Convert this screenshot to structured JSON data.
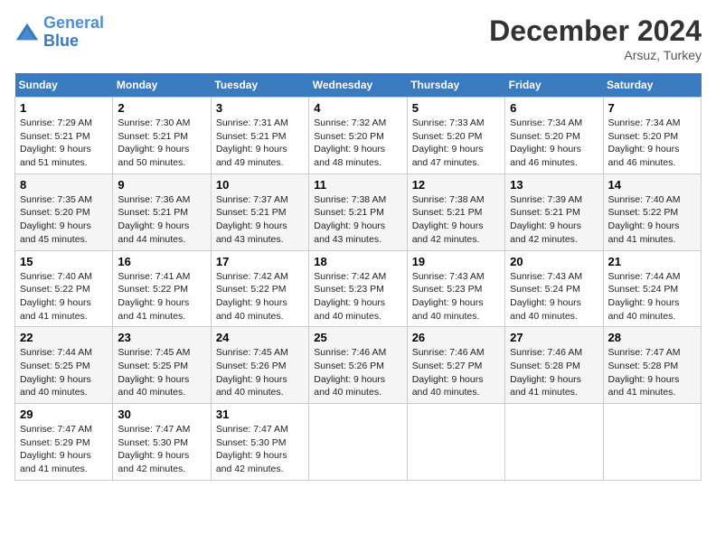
{
  "header": {
    "logo_line1": "General",
    "logo_line2": "Blue",
    "month": "December 2024",
    "location": "Arsuz, Turkey"
  },
  "days_of_week": [
    "Sunday",
    "Monday",
    "Tuesday",
    "Wednesday",
    "Thursday",
    "Friday",
    "Saturday"
  ],
  "weeks": [
    [
      {
        "day": 1,
        "sunrise": "7:29 AM",
        "sunset": "5:21 PM",
        "daylight": "9 hours and 51 minutes."
      },
      {
        "day": 2,
        "sunrise": "7:30 AM",
        "sunset": "5:21 PM",
        "daylight": "9 hours and 50 minutes."
      },
      {
        "day": 3,
        "sunrise": "7:31 AM",
        "sunset": "5:21 PM",
        "daylight": "9 hours and 49 minutes."
      },
      {
        "day": 4,
        "sunrise": "7:32 AM",
        "sunset": "5:20 PM",
        "daylight": "9 hours and 48 minutes."
      },
      {
        "day": 5,
        "sunrise": "7:33 AM",
        "sunset": "5:20 PM",
        "daylight": "9 hours and 47 minutes."
      },
      {
        "day": 6,
        "sunrise": "7:34 AM",
        "sunset": "5:20 PM",
        "daylight": "9 hours and 46 minutes."
      },
      {
        "day": 7,
        "sunrise": "7:34 AM",
        "sunset": "5:20 PM",
        "daylight": "9 hours and 46 minutes."
      }
    ],
    [
      {
        "day": 8,
        "sunrise": "7:35 AM",
        "sunset": "5:20 PM",
        "daylight": "9 hours and 45 minutes."
      },
      {
        "day": 9,
        "sunrise": "7:36 AM",
        "sunset": "5:21 PM",
        "daylight": "9 hours and 44 minutes."
      },
      {
        "day": 10,
        "sunrise": "7:37 AM",
        "sunset": "5:21 PM",
        "daylight": "9 hours and 43 minutes."
      },
      {
        "day": 11,
        "sunrise": "7:38 AM",
        "sunset": "5:21 PM",
        "daylight": "9 hours and 43 minutes."
      },
      {
        "day": 12,
        "sunrise": "7:38 AM",
        "sunset": "5:21 PM",
        "daylight": "9 hours and 42 minutes."
      },
      {
        "day": 13,
        "sunrise": "7:39 AM",
        "sunset": "5:21 PM",
        "daylight": "9 hours and 42 minutes."
      },
      {
        "day": 14,
        "sunrise": "7:40 AM",
        "sunset": "5:22 PM",
        "daylight": "9 hours and 41 minutes."
      }
    ],
    [
      {
        "day": 15,
        "sunrise": "7:40 AM",
        "sunset": "5:22 PM",
        "daylight": "9 hours and 41 minutes."
      },
      {
        "day": 16,
        "sunrise": "7:41 AM",
        "sunset": "5:22 PM",
        "daylight": "9 hours and 41 minutes."
      },
      {
        "day": 17,
        "sunrise": "7:42 AM",
        "sunset": "5:22 PM",
        "daylight": "9 hours and 40 minutes."
      },
      {
        "day": 18,
        "sunrise": "7:42 AM",
        "sunset": "5:23 PM",
        "daylight": "9 hours and 40 minutes."
      },
      {
        "day": 19,
        "sunrise": "7:43 AM",
        "sunset": "5:23 PM",
        "daylight": "9 hours and 40 minutes."
      },
      {
        "day": 20,
        "sunrise": "7:43 AM",
        "sunset": "5:24 PM",
        "daylight": "9 hours and 40 minutes."
      },
      {
        "day": 21,
        "sunrise": "7:44 AM",
        "sunset": "5:24 PM",
        "daylight": "9 hours and 40 minutes."
      }
    ],
    [
      {
        "day": 22,
        "sunrise": "7:44 AM",
        "sunset": "5:25 PM",
        "daylight": "9 hours and 40 minutes."
      },
      {
        "day": 23,
        "sunrise": "7:45 AM",
        "sunset": "5:25 PM",
        "daylight": "9 hours and 40 minutes."
      },
      {
        "day": 24,
        "sunrise": "7:45 AM",
        "sunset": "5:26 PM",
        "daylight": "9 hours and 40 minutes."
      },
      {
        "day": 25,
        "sunrise": "7:46 AM",
        "sunset": "5:26 PM",
        "daylight": "9 hours and 40 minutes."
      },
      {
        "day": 26,
        "sunrise": "7:46 AM",
        "sunset": "5:27 PM",
        "daylight": "9 hours and 40 minutes."
      },
      {
        "day": 27,
        "sunrise": "7:46 AM",
        "sunset": "5:28 PM",
        "daylight": "9 hours and 41 minutes."
      },
      {
        "day": 28,
        "sunrise": "7:47 AM",
        "sunset": "5:28 PM",
        "daylight": "9 hours and 41 minutes."
      }
    ],
    [
      {
        "day": 29,
        "sunrise": "7:47 AM",
        "sunset": "5:29 PM",
        "daylight": "9 hours and 41 minutes."
      },
      {
        "day": 30,
        "sunrise": "7:47 AM",
        "sunset": "5:30 PM",
        "daylight": "9 hours and 42 minutes."
      },
      {
        "day": 31,
        "sunrise": "7:47 AM",
        "sunset": "5:30 PM",
        "daylight": "9 hours and 42 minutes."
      },
      null,
      null,
      null,
      null
    ]
  ]
}
